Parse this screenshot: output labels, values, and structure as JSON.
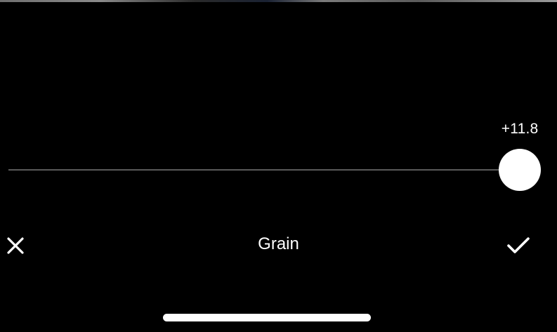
{
  "editor": {
    "tool_name": "Grain",
    "slider": {
      "value_text": "+11.8",
      "position_fraction": 0.958
    },
    "cancel_icon": "close-icon",
    "confirm_icon": "checkmark-icon"
  },
  "colors": {
    "background": "#000000",
    "foreground": "#ffffff",
    "track": "#5a5a5a"
  }
}
